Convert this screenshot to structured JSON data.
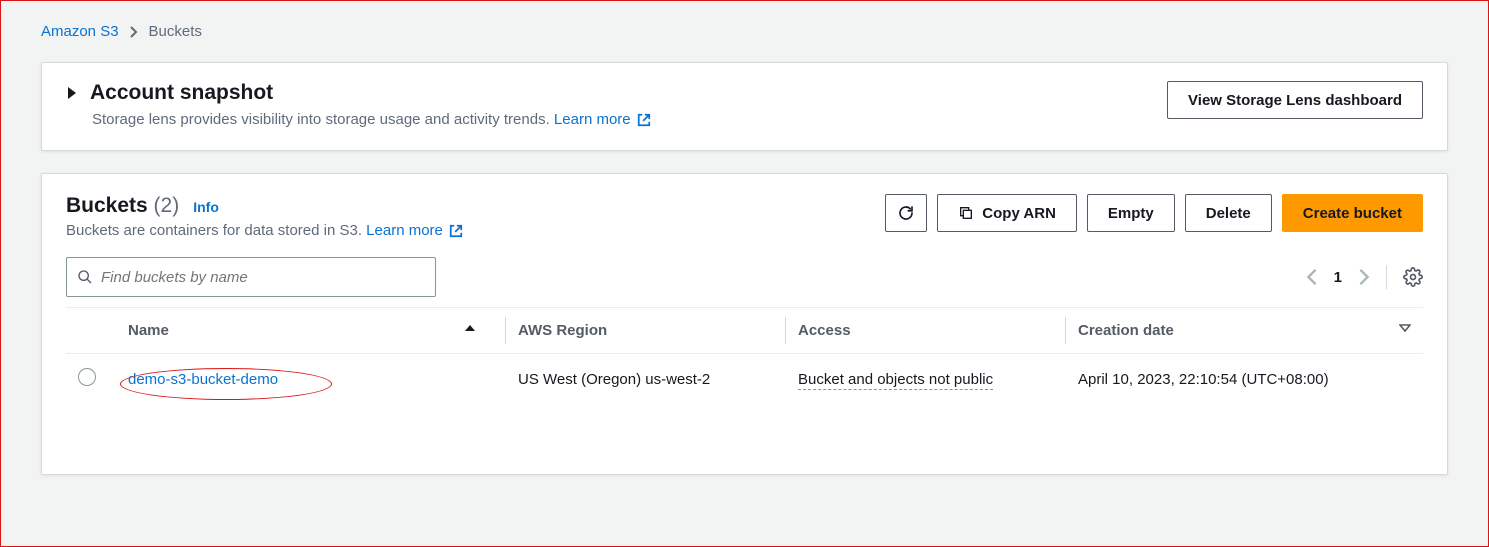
{
  "breadcrumb": {
    "root": "Amazon S3",
    "current": "Buckets"
  },
  "snapshot": {
    "title": "Account snapshot",
    "subtitle": "Storage lens provides visibility into storage usage and activity trends.",
    "learn_more": "Learn more",
    "view_dash_btn": "View Storage Lens dashboard"
  },
  "buckets": {
    "title": "Buckets",
    "count": "(2)",
    "info_label": "Info",
    "subtitle": "Buckets are containers for data stored in S3.",
    "learn_more": "Learn more",
    "search_placeholder": "Find buckets by name",
    "page_number": "1",
    "actions": {
      "copy_arn": "Copy ARN",
      "empty": "Empty",
      "delete": "Delete",
      "create": "Create bucket"
    },
    "columns": {
      "name": "Name",
      "region": "AWS Region",
      "access": "Access",
      "created": "Creation date"
    },
    "rows": [
      {
        "name": "demo-s3-bucket-demo",
        "region": "US West (Oregon) us-west-2",
        "access": "Bucket and objects not public",
        "created": "April 10, 2023, 22:10:54 (UTC+08:00)"
      }
    ]
  }
}
